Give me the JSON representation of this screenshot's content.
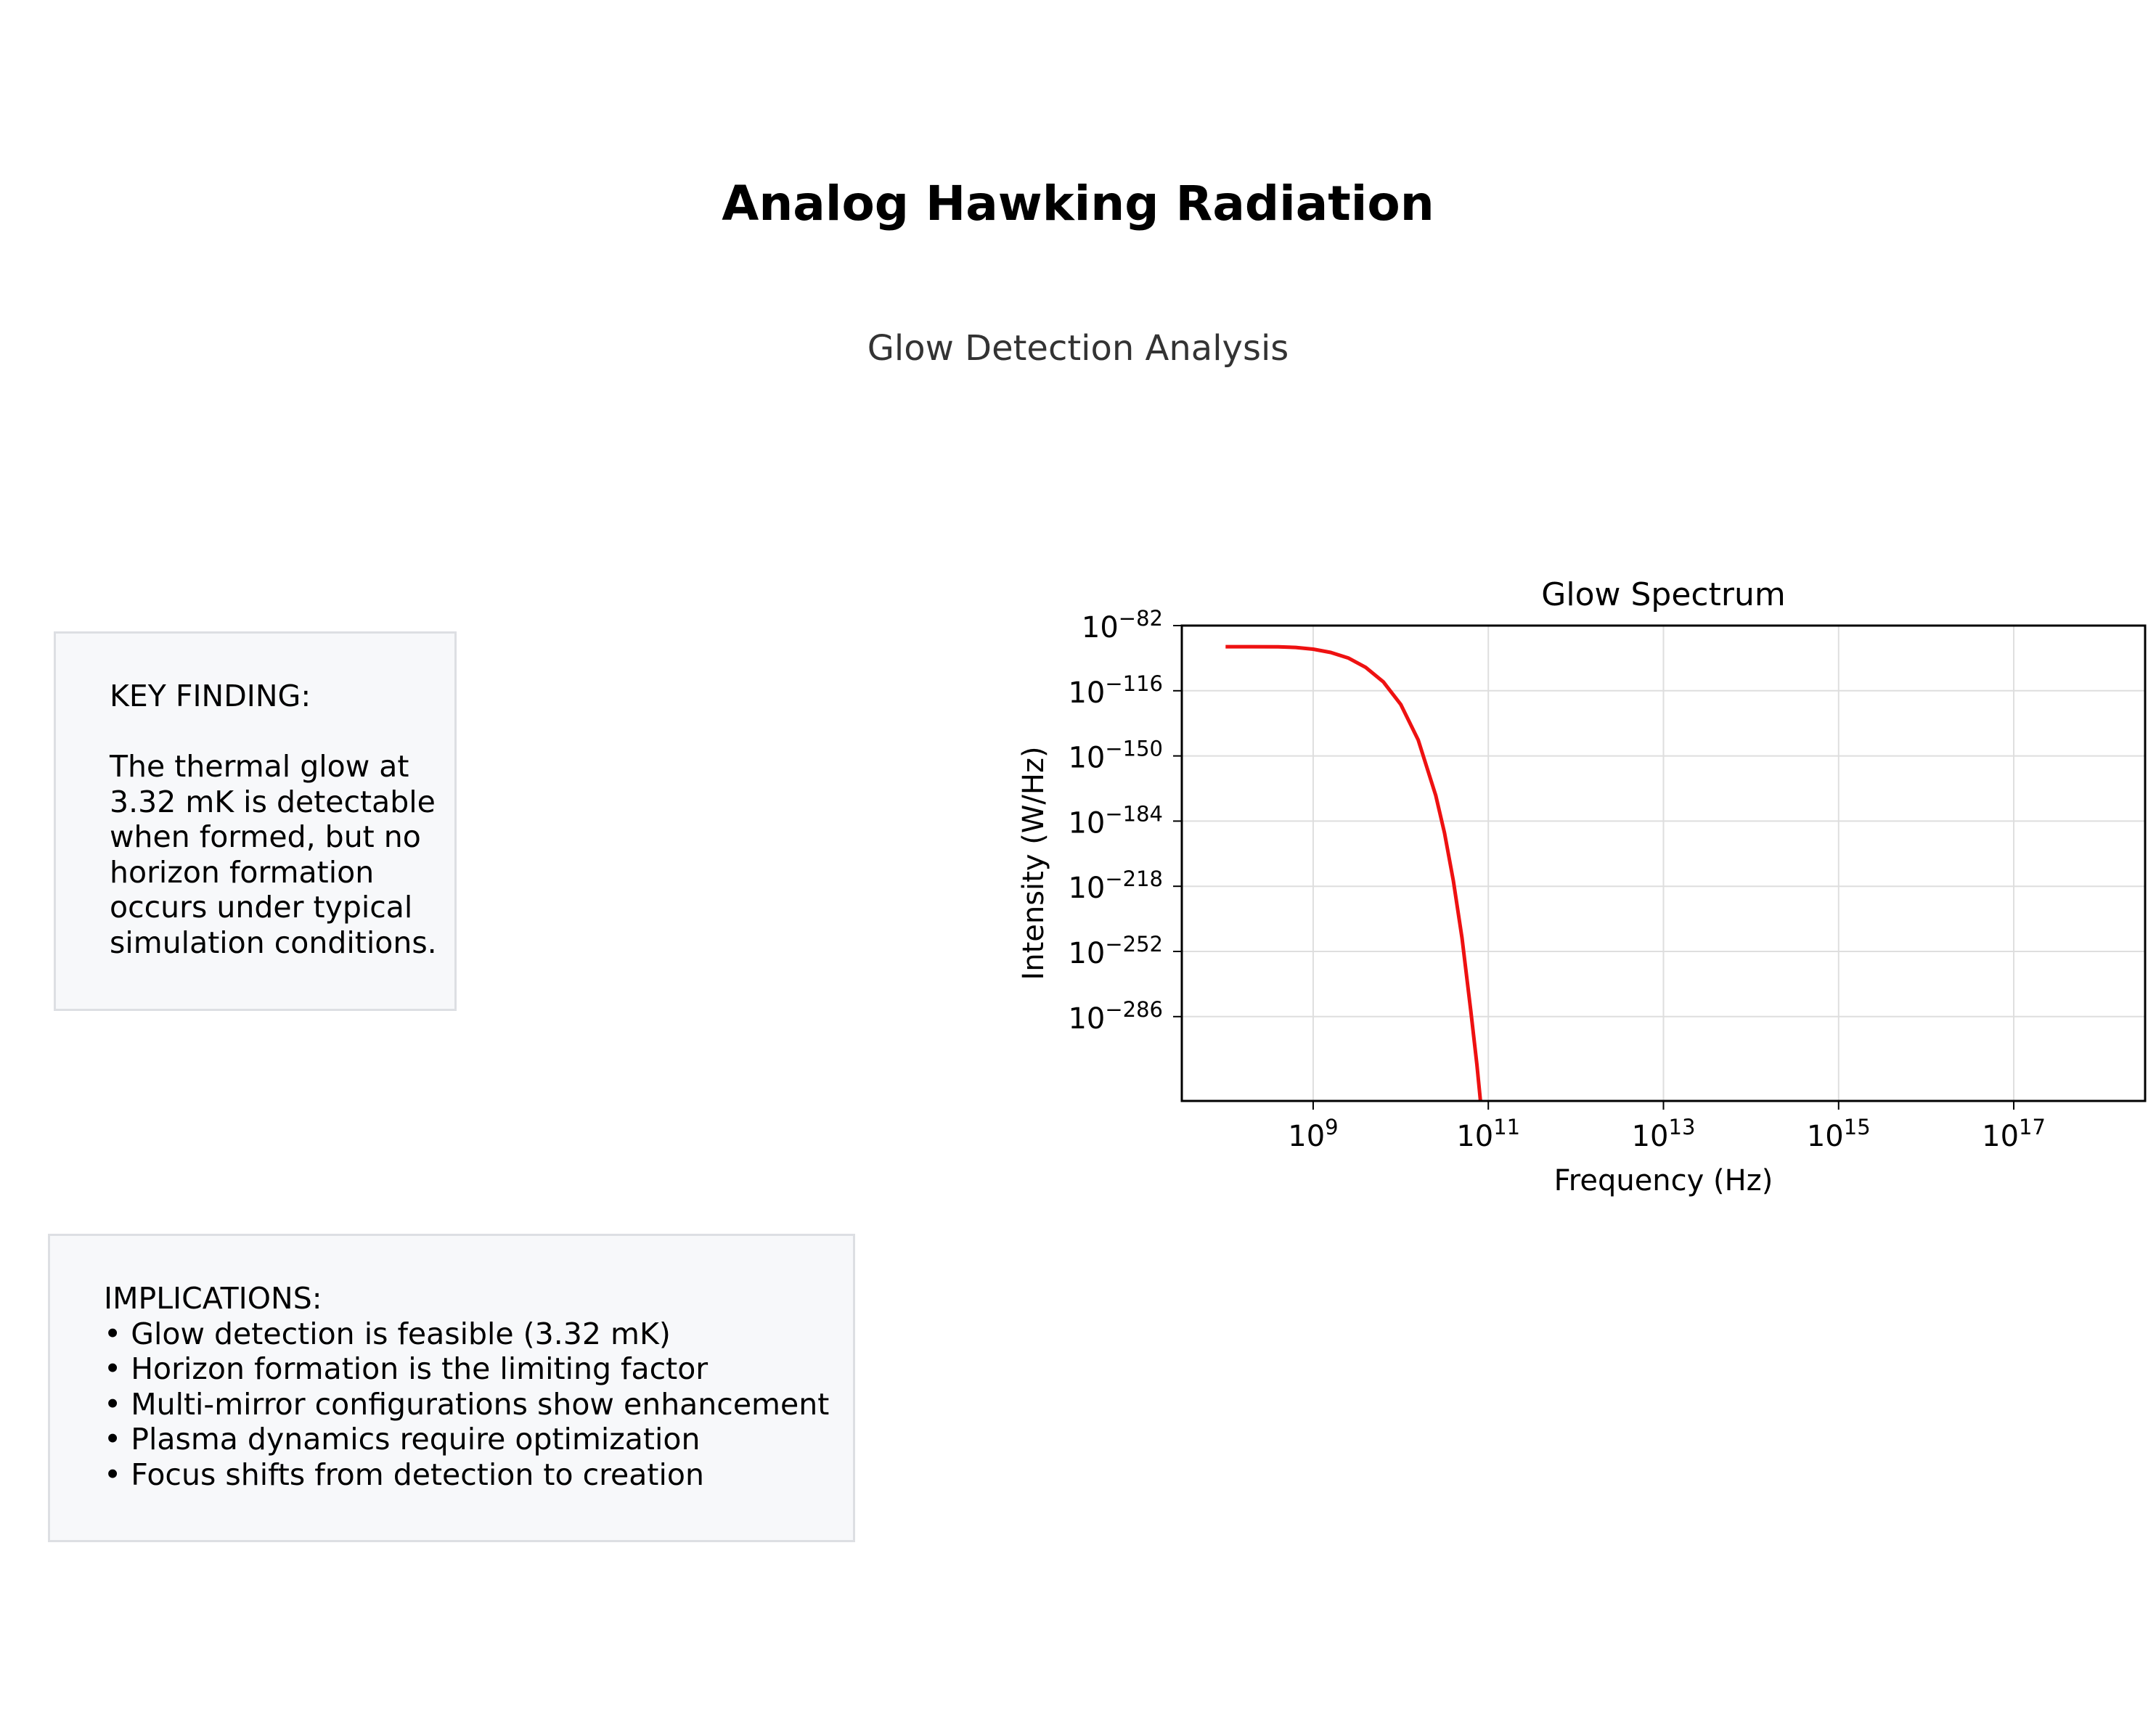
{
  "header": {
    "title": "Analog Hawking Radiation",
    "subtitle": "Glow Detection Analysis"
  },
  "key_finding": {
    "heading": "KEY FINDING:",
    "body": "The thermal glow at\n3.32 mK is detectable\nwhen formed, but no\nhorizon formation\noccurs under typical\nsimulation conditions."
  },
  "implications": {
    "heading": "IMPLICATIONS:",
    "items": [
      "• Glow detection is feasible (3.32 mK)",
      "• Horizon formation is the limiting factor",
      "• Multi-mirror configurations show enhancement",
      "• Plasma dynamics require optimization",
      "• Focus shifts from detection to creation"
    ]
  },
  "chart_data": {
    "type": "line",
    "title": "Glow Spectrum",
    "xlabel": "Frequency (Hz)",
    "ylabel": "Intensity (W/Hz)",
    "xscale": "log",
    "yscale": "log",
    "xlim_exp": [
      7.5,
      18.5
    ],
    "ylim_exp": [
      -82,
      -330
    ],
    "x_ticks_exp": [
      9,
      11,
      13,
      15,
      17
    ],
    "y_ticks_exp": [
      -82,
      -116,
      -150,
      -184,
      -218,
      -252,
      -286
    ],
    "grid": true,
    "line_color": "#ee1111",
    "series": [
      {
        "points_exp": [
          [
            8.0,
            -93.0
          ],
          [
            8.3,
            -93.0
          ],
          [
            8.6,
            -93.1
          ],
          [
            8.8,
            -93.4
          ],
          [
            9.0,
            -94.3
          ],
          [
            9.2,
            -96.0
          ],
          [
            9.4,
            -98.9
          ],
          [
            9.6,
            -103.8
          ],
          [
            9.8,
            -111.3
          ],
          [
            10.0,
            -123.1
          ],
          [
            10.2,
            -141.7
          ],
          [
            10.4,
            -170.6
          ],
          [
            10.5,
            -190.2
          ],
          [
            10.6,
            -215.0
          ],
          [
            10.7,
            -245.0
          ],
          [
            10.8,
            -283.0
          ],
          [
            10.87,
            -311.0
          ],
          [
            10.91,
            -330.0
          ]
        ]
      }
    ]
  }
}
